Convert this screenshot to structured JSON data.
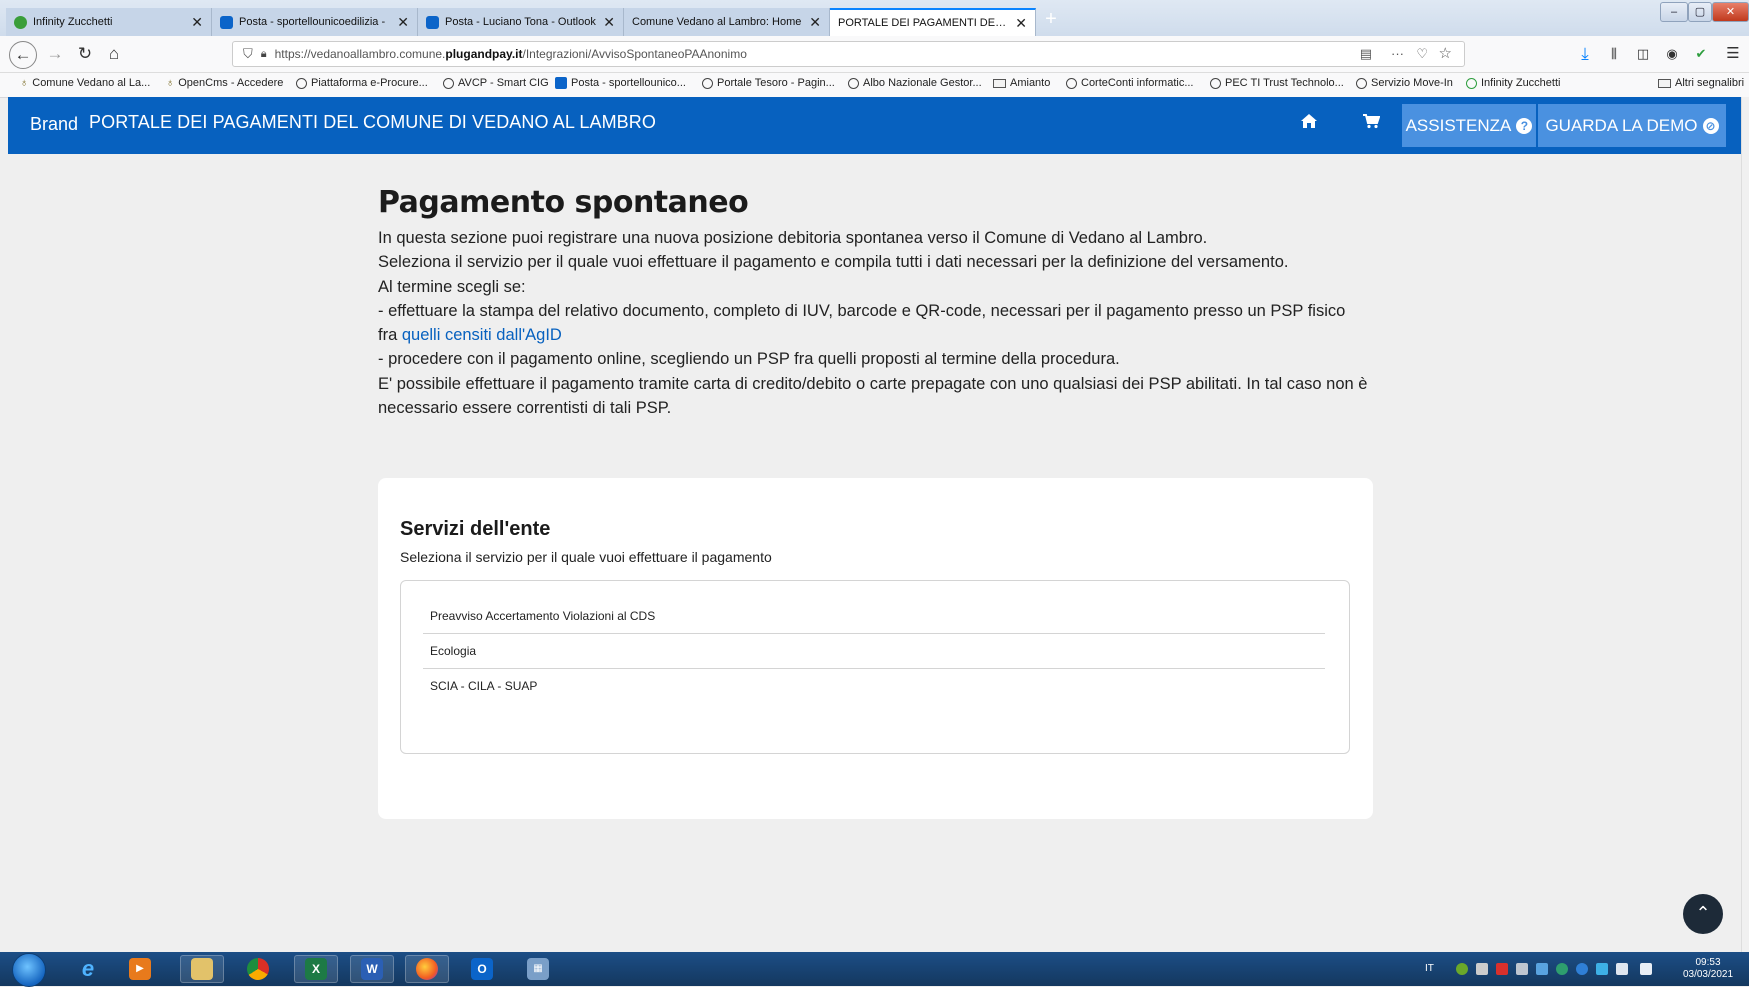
{
  "browser": {
    "tabs": [
      {
        "label": "Infinity Zucchetti",
        "color": "#3a9e3a"
      },
      {
        "label": "Posta - sportellounicoedilizia - ",
        "color": "#0b64c9"
      },
      {
        "label": "Posta - Luciano Tona - Outlook",
        "color": "#0b64c9"
      },
      {
        "label": "Comune Vedano al Lambro: Home",
        "color": "#c6d5e8"
      },
      {
        "label": "PORTALE DEI PAGAMENTI DEL CO",
        "color": "#ffffff"
      }
    ],
    "tab_close_glyph": "✕",
    "new_tab_glyph": "+",
    "url_prefix": "https://vedanoallambro.comune.",
    "url_domain": "plugandpay.it",
    "url_path": "/Integrazioni/AvvisoSpontaneoPAAnonimo",
    "bookmarks": [
      {
        "label": "Comune Vedano al La...",
        "icon": "comune-logo-icon"
      },
      {
        "label": "OpenCms - Accedere",
        "icon": "comune-logo-icon"
      },
      {
        "label": "Piattaforma e-Procure...",
        "icon": "globe-icon"
      },
      {
        "label": "AVCP - Smart CIG",
        "icon": "globe-icon"
      },
      {
        "label": "Posta - sportellounico...",
        "icon": "outlook-icon"
      },
      {
        "label": "Portale Tesoro - Pagin...",
        "icon": "globe-icon"
      },
      {
        "label": "Albo Nazionale Gestor...",
        "icon": "globe-icon"
      },
      {
        "label": "Amianto",
        "icon": "folder-icon"
      },
      {
        "label": "CorteConti informatic...",
        "icon": "globe-icon"
      },
      {
        "label": "PEC TI Trust Technolo...",
        "icon": "globe-icon"
      },
      {
        "label": "Servizio Move-In",
        "icon": "globe-icon"
      },
      {
        "label": "Infinity Zucchetti",
        "icon": "ie-icon"
      }
    ],
    "other_bookmarks": "Altri segnalibri"
  },
  "header": {
    "brand": "Brand",
    "title": "PORTALE DEI PAGAMENTI DEL COMUNE DI VEDANO AL LAMBRO",
    "assistenza_label": "ASSISTENZA",
    "assistenza_icon": "?",
    "demo_label": "GUARDA LA DEMO",
    "demo_icon": "⊘",
    "background": "#0761bf",
    "button_color": "#4a91e0"
  },
  "content": {
    "heading": "Pagamento spontaneo",
    "p1": "In questa sezione puoi registrare una nuova posizione debitoria spontanea verso il Comune di Vedano al Lambro.",
    "p2": "Seleziona il servizio per il quale vuoi effettuare il pagamento e compila tutti i dati necessari per la definizione del versamento.",
    "p3": "Al termine scegli se:",
    "p4_before_link": "- effettuare la stampa del relativo documento, completo di IUV, barcode e QR-code, necessari per il pagamento presso un PSP fisico fra ",
    "p4_link": "quelli censiti dall'AgID",
    "p5": "- procedere con il pagamento online, scegliendo un PSP fra quelli proposti al termine della procedura.",
    "p6": "E' possibile effettuare il pagamento tramite carta di credito/debito o carte prepagate con uno qualsiasi dei PSP abilitati. In tal caso non è necessario essere correntisti di tali PSP."
  },
  "services": {
    "title": "Servizi dell'ente",
    "subtitle": "Seleziona il servizio per il quale vuoi effettuare il pagamento",
    "items": [
      "Preavviso Accertamento Violazioni al CDS",
      "Ecologia",
      "SCIA - CILA - SUAP"
    ]
  },
  "scroll_top_glyph": "⌃",
  "taskbar": {
    "language": "IT",
    "time": "09:53",
    "date": "03/03/2021"
  }
}
